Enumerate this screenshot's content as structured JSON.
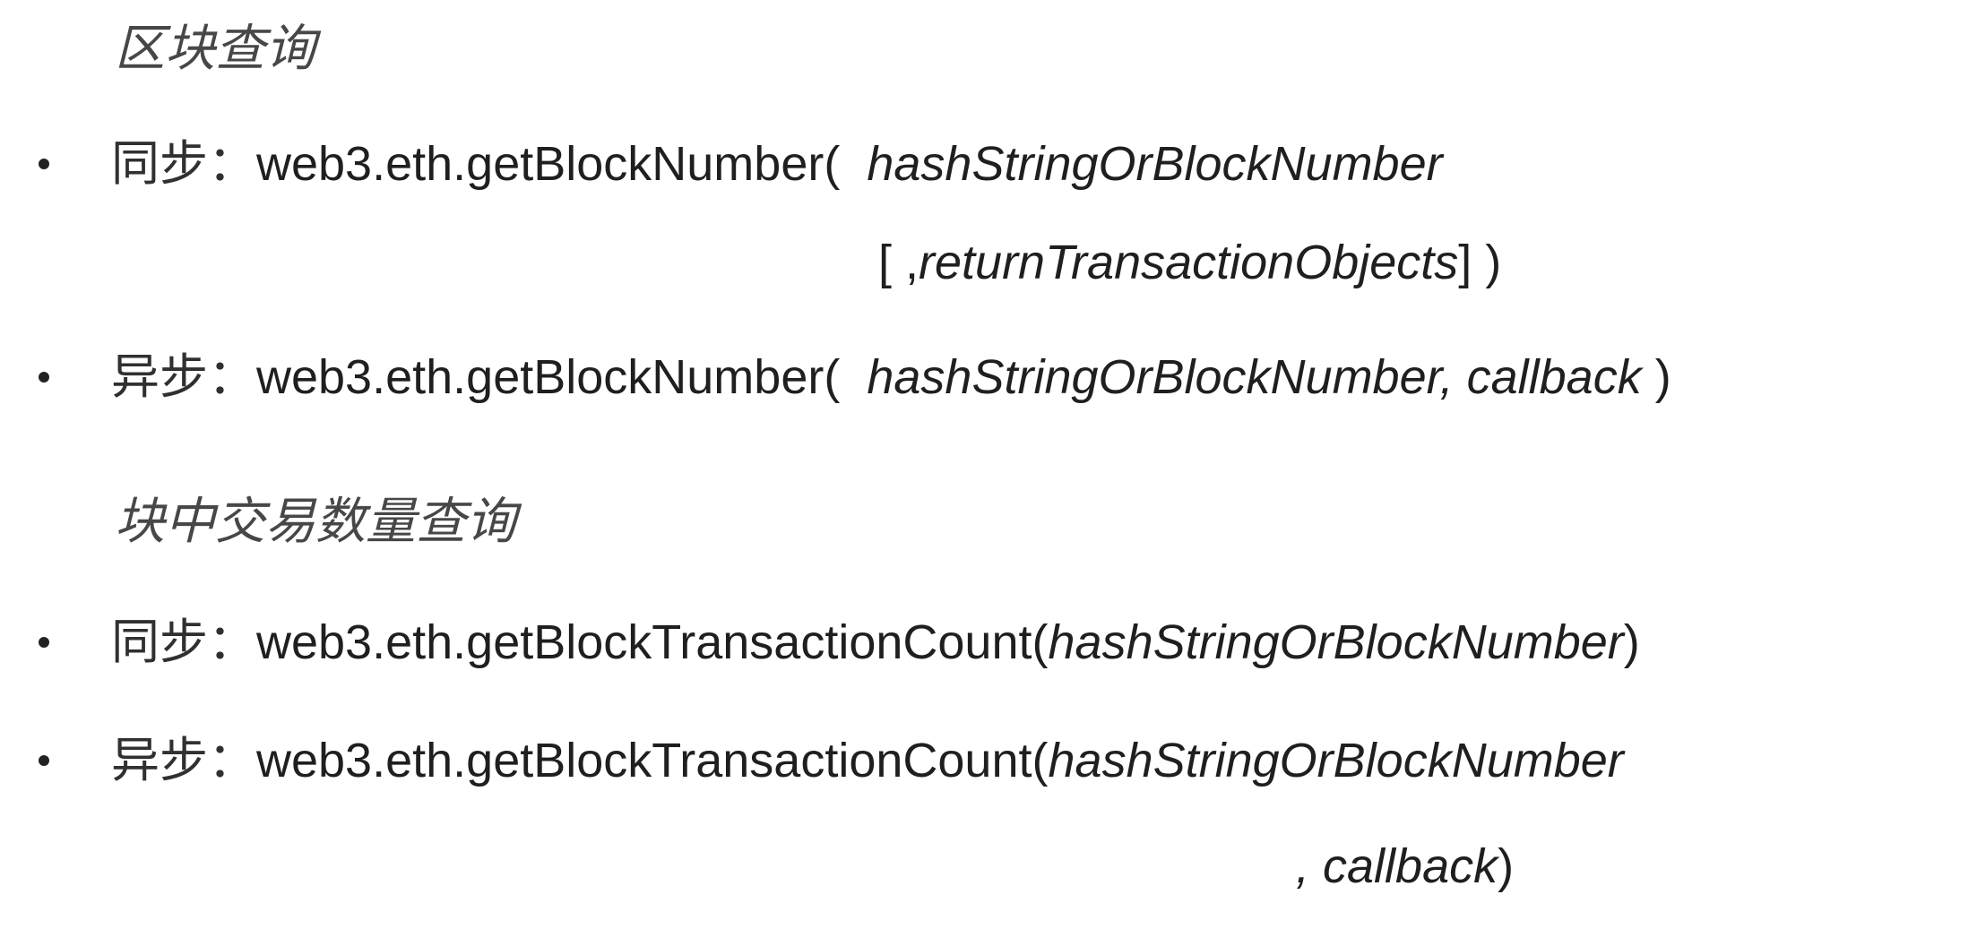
{
  "sections": [
    {
      "heading": "区块查询",
      "items": [
        {
          "label": "同步",
          "separator": "：",
          "function": "web3.eth.getBlockNumber(",
          "args": "hashStringOrBlockNumber",
          "continuation_open": "[ ,",
          "continuation_arg": "returnTransactionObjects",
          "continuation_close": "] )"
        },
        {
          "label": "异步",
          "separator": "：",
          "function": "web3.eth.getBlockNumber(",
          "args": "hashStringOrBlockNumber, callback",
          "close": " )"
        }
      ]
    },
    {
      "heading": "块中交易数量查询",
      "items": [
        {
          "label": "同步",
          "separator": "：",
          "function": "web3.eth.getBlockTransactionCount(",
          "args": "hashStringOrBlockNumber",
          "close": ")"
        },
        {
          "label": "异步",
          "separator": "：",
          "function": "web3.eth.getBlockTransactionCount(",
          "args": "hashStringOrBlockNumber",
          "continuation_arg": ", callback",
          "continuation_close": ")"
        }
      ]
    }
  ]
}
